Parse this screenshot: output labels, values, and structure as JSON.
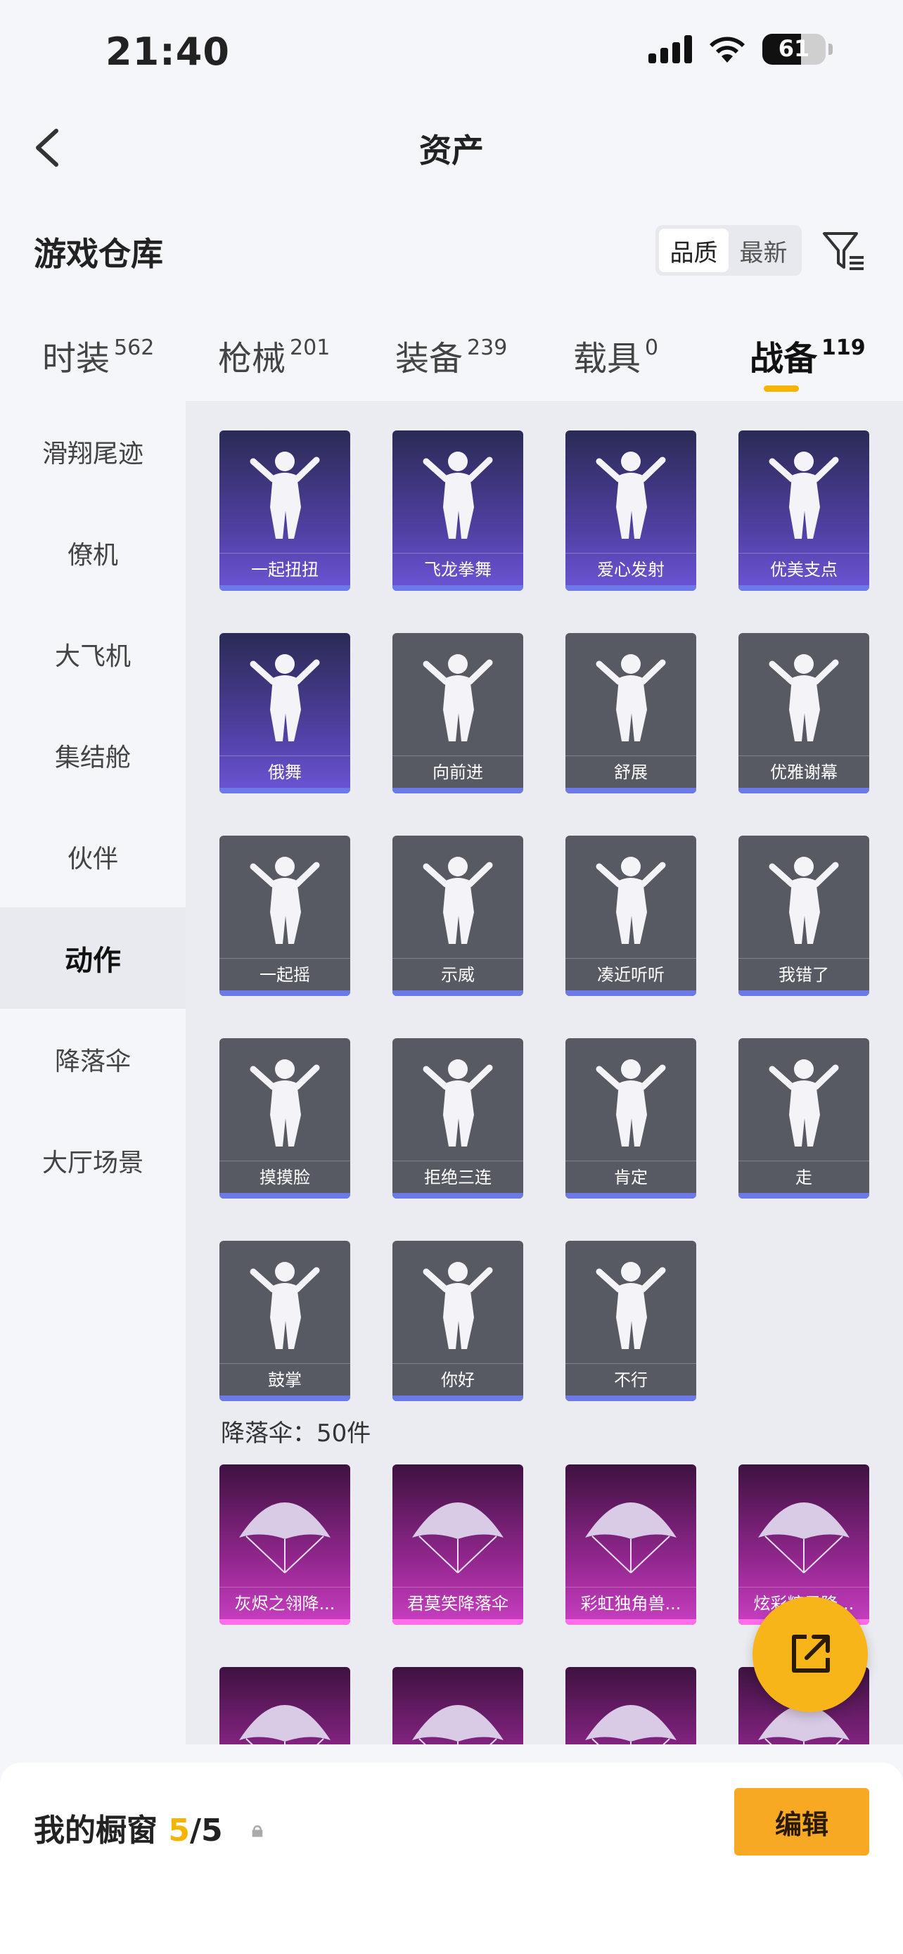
{
  "status": {
    "time": "21:40",
    "battery": "61",
    "battery_level": 0.61
  },
  "nav": {
    "title": "资产"
  },
  "warehouse": {
    "title": "游戏仓库",
    "sort_quality": "品质",
    "sort_newest": "最新"
  },
  "tabs": [
    {
      "label": "时装",
      "count": "562"
    },
    {
      "label": "枪械",
      "count": "201"
    },
    {
      "label": "装备",
      "count": "239"
    },
    {
      "label": "载具",
      "count": "0"
    },
    {
      "label": "战备",
      "count": "119",
      "active": true
    }
  ],
  "sidebar": [
    {
      "label": "滑翔尾迹"
    },
    {
      "label": "僚机"
    },
    {
      "label": "大飞机"
    },
    {
      "label": "集结舱"
    },
    {
      "label": "伙伴"
    },
    {
      "label": "动作",
      "active": true
    },
    {
      "label": "降落伞"
    },
    {
      "label": "大厅场景"
    }
  ],
  "actions": [
    {
      "name": "一起扭扭",
      "rarity": "purple",
      "icon": "dance-figure-icon"
    },
    {
      "name": "飞龙拳舞",
      "rarity": "purple",
      "icon": "dragon-dance-icon"
    },
    {
      "name": "爱心发射",
      "rarity": "purple",
      "icon": "heart-figure-icon"
    },
    {
      "name": "优美支点",
      "rarity": "purple",
      "icon": "dance-figure-icon"
    },
    {
      "name": "俄舞",
      "rarity": "purple",
      "icon": "dance-figure-icon"
    },
    {
      "name": "向前进",
      "rarity": "grey",
      "icon": "walk-figure-icon"
    },
    {
      "name": "舒展",
      "rarity": "grey",
      "icon": "stretch-figure-icon"
    },
    {
      "name": "优雅谢幕",
      "rarity": "grey",
      "icon": "bow-figure-icon"
    },
    {
      "name": "一起摇",
      "rarity": "grey",
      "icon": "shake-figure-icon"
    },
    {
      "name": "示威",
      "rarity": "grey",
      "icon": "flex-figure-icon"
    },
    {
      "name": "凑近听听",
      "rarity": "grey",
      "icon": "listen-figure-icon"
    },
    {
      "name": "我错了",
      "rarity": "grey",
      "icon": "sorry-figure-icon"
    },
    {
      "name": "摸摸脸",
      "rarity": "grey",
      "icon": "touch-face-icon"
    },
    {
      "name": "拒绝三连",
      "rarity": "grey",
      "icon": "cross-arms-icon"
    },
    {
      "name": "肯定",
      "rarity": "grey",
      "icon": "nod-head-icon"
    },
    {
      "name": "走",
      "rarity": "grey",
      "icon": "point-hand-icon"
    },
    {
      "name": "鼓掌",
      "rarity": "grey",
      "icon": "clap-hands-icon"
    },
    {
      "name": "你好",
      "rarity": "grey",
      "icon": "wave-hand-icon"
    },
    {
      "name": "不行",
      "rarity": "grey",
      "icon": "shake-head-icon"
    }
  ],
  "parachute_section": {
    "label": "降落伞：50件"
  },
  "parachutes": [
    {
      "name": "灰烬之翎降...",
      "icon": "parachute-icon"
    },
    {
      "name": "君莫笑降落伞",
      "icon": "parachute-icon"
    },
    {
      "name": "彩虹独角兽...",
      "icon": "parachute-icon"
    },
    {
      "name": "炫彩糖果降...",
      "icon": "parachute-icon"
    },
    {
      "name": "",
      "icon": "parachute-icon"
    },
    {
      "name": "",
      "icon": "parachute-icon"
    },
    {
      "name": "",
      "icon": "parachute-icon"
    },
    {
      "name": "",
      "icon": "parachute-icon"
    }
  ],
  "showcase": {
    "label": "我的橱窗",
    "current": "5",
    "sep_total": "/5",
    "edit": "编辑"
  },
  "colors": {
    "accent": "#f5b400",
    "purple": "#5a48c0",
    "grey": "#575a62",
    "pink": "#b02fa8"
  }
}
